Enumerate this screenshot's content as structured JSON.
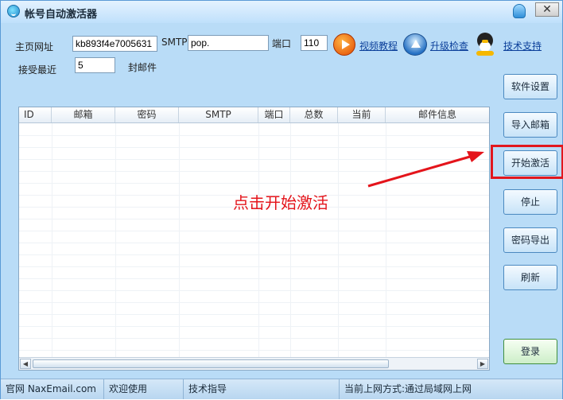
{
  "window": {
    "title": "帐号自动激活器",
    "close_glyph": "✕",
    "icons": {
      "app": "smiley-app-icon",
      "minimize": "minimize-icon",
      "close": "close-icon"
    }
  },
  "form": {
    "homepage_label": "主页网址",
    "homepage_value": "kb893f4e7005631",
    "smtp_label": "SMTP",
    "smtp_value": "pop.",
    "port_label": "端口",
    "port_value": "110",
    "recent_label": "接受最近",
    "recent_value": "5",
    "recent_suffix": "封邮件"
  },
  "links": {
    "video_tutorial": "视频教程",
    "upgrade_check": "升级检查",
    "tech_support": "技术支持",
    "icons": {
      "video": "play-icon",
      "upgrade": "upgrade-icon",
      "support": "qq-penguin-icon"
    }
  },
  "buttons": {
    "software_settings": "软件设置",
    "import_email": "导入邮箱",
    "start_activation": "开始激活",
    "stop": "停止",
    "export_passwords": "密码导出",
    "refresh": "刷新",
    "login": "登录"
  },
  "table": {
    "columns": [
      "ID",
      "邮箱",
      "密码",
      "SMTP",
      "端口",
      "总数",
      "当前",
      "邮件信息"
    ],
    "rows": []
  },
  "annotation": {
    "text": "点击开始激活",
    "color": "#e4141b"
  },
  "statusbar": {
    "official_site": "官网 NaxEmail.com",
    "welcome": "欢迎使用",
    "tech_guide": "技术指导",
    "network_mode": "当前上网方式:通过局域网上网"
  },
  "colors": {
    "window_bg": "#b9dcf7",
    "highlight": "#e1171e"
  }
}
